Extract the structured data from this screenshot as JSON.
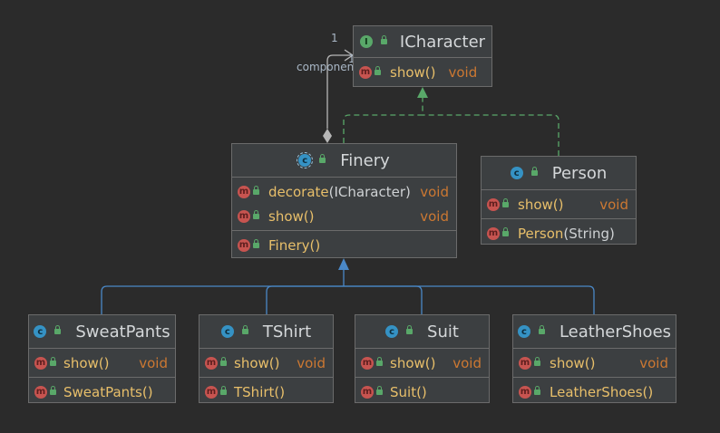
{
  "colors": {
    "background": "#2b2b2b",
    "node_fill": "#3c3f41",
    "method_name": "#e8bf6a",
    "return_type": "#cc7832",
    "implements_arrow": "#59a869",
    "extends_arrow": "#4a88c7",
    "aggregation": "#b6b6b6"
  },
  "nodes": {
    "icharacter": {
      "kind_icon": "interface-icon",
      "badge": "I",
      "title": "ICharacter",
      "methods": [
        {
          "name": "show()",
          "ret": "void"
        }
      ]
    },
    "finery": {
      "kind_icon": "abstract-class-icon",
      "badge": "c",
      "title": "Finery",
      "methods": [
        {
          "name": "decorate",
          "param": "(ICharacter)",
          "ret": "void"
        },
        {
          "name": "show()",
          "ret": "void"
        }
      ],
      "constructors": [
        {
          "name": "Finery()"
        }
      ]
    },
    "person": {
      "kind_icon": "class-icon",
      "badge": "c",
      "title": "Person",
      "methods": [
        {
          "name": "show()",
          "ret": "void"
        }
      ],
      "constructors": [
        {
          "name": "Person",
          "param": "(String)"
        }
      ]
    },
    "sweatpants": {
      "kind_icon": "class-icon",
      "badge": "c",
      "title": "SweatPants",
      "methods": [
        {
          "name": "show()",
          "ret": "void"
        }
      ],
      "constructors": [
        {
          "name": "SweatPants()"
        }
      ]
    },
    "tshirt": {
      "kind_icon": "class-icon",
      "badge": "c",
      "title": "TShirt",
      "methods": [
        {
          "name": "show()",
          "ret": "void"
        }
      ],
      "constructors": [
        {
          "name": "TShirt()"
        }
      ]
    },
    "suit": {
      "kind_icon": "class-icon",
      "badge": "c",
      "title": "Suit",
      "methods": [
        {
          "name": "show()",
          "ret": "void"
        }
      ],
      "constructors": [
        {
          "name": "Suit()"
        }
      ]
    },
    "leathershoes": {
      "kind_icon": "class-icon",
      "badge": "c",
      "title": "LeatherShoes",
      "methods": [
        {
          "name": "show()",
          "ret": "void"
        }
      ],
      "constructors": [
        {
          "name": "LeatherShoes()"
        }
      ]
    }
  },
  "method_badge": "m",
  "edges": {
    "aggregation": {
      "from": "Finery",
      "to": "ICharacter",
      "multiplicity_top": "1",
      "multiplicity_end": "1",
      "role": "component"
    },
    "implements": [
      {
        "from": "Finery",
        "to": "ICharacter"
      },
      {
        "from": "Person",
        "to": "ICharacter"
      }
    ],
    "extends": [
      {
        "from": "SweatPants",
        "to": "Finery"
      },
      {
        "from": "TShirt",
        "to": "Finery"
      },
      {
        "from": "Suit",
        "to": "Finery"
      },
      {
        "from": "LeatherShoes",
        "to": "Finery"
      }
    ]
  }
}
